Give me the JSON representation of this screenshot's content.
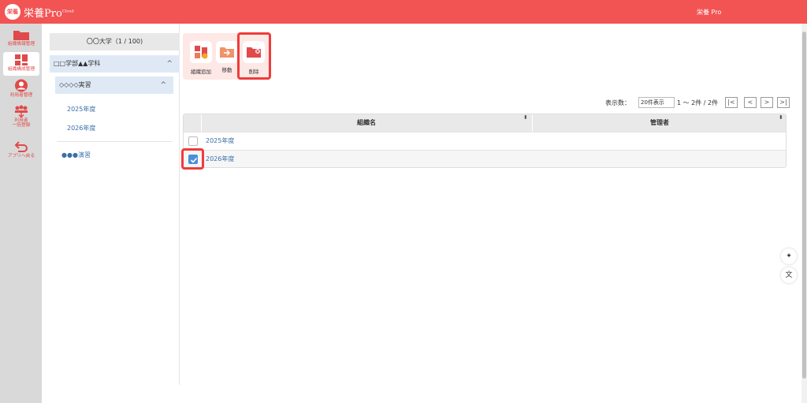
{
  "header": {
    "logo_badge": "栄養",
    "logo_text": "栄養Pro",
    "logo_cloud": "Cloud",
    "user": "栄養 Pro"
  },
  "sidenav": {
    "items": [
      {
        "label": "組織情報管理",
        "icon": "folder-icon"
      },
      {
        "label": "組織構成管理",
        "icon": "layout-icon"
      },
      {
        "label": "利用者管理",
        "icon": "user-icon"
      },
      {
        "label": "利用者\n一括登録",
        "label1": "利用者",
        "label2": "一括登録",
        "icon": "users-upload-icon"
      },
      {
        "label": "アプリへ戻る",
        "icon": "back-arrow-icon"
      }
    ]
  },
  "tree": {
    "root": "〇〇大学（1 / 100)",
    "dept": "□□学部▲▲学科",
    "sub": "◇◇◇◇実習",
    "leaves": [
      "2025年度",
      "2026年度"
    ],
    "other": "●●●演習"
  },
  "toolbar": {
    "add": "組織追加",
    "move": "移動",
    "delete": "削除"
  },
  "pager": {
    "label": "表示数：",
    "select": "20件表示",
    "count": "1 〜 2件 / 2件",
    "first": "|<",
    "prev": "<",
    "next": ">",
    "last": ">|"
  },
  "table": {
    "col_name": "組織名",
    "col_manager": "管理者",
    "rows": [
      {
        "name": "2025年度",
        "checked": false,
        "manager": ""
      },
      {
        "name": "2026年度",
        "checked": true,
        "manager": ""
      }
    ]
  },
  "colors": {
    "brand": "#f25454",
    "highlight": "#f03b3b",
    "link": "#3a6fa8",
    "checkbox": "#4a90d9"
  }
}
